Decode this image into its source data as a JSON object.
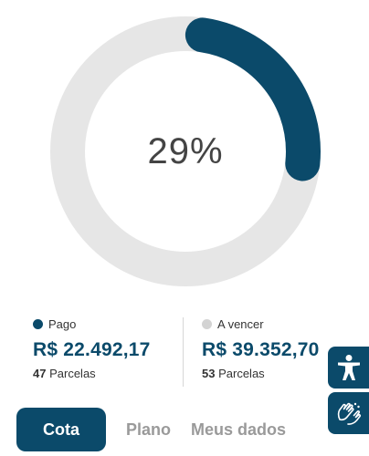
{
  "progress": {
    "percent_label": "29%",
    "fraction": 0.29,
    "colors": {
      "filled": "#0b4a6a",
      "track": "#e6e6e6"
    }
  },
  "summary": {
    "paid": {
      "legend": "Pago",
      "amount": "R$ 22.492,17",
      "count": "47",
      "count_label": "Parcelas",
      "color": "#0b4a6a"
    },
    "due": {
      "legend": "A vencer",
      "amount": "R$ 39.352,70",
      "count": "53",
      "count_label": "Parcelas",
      "color": "#d3d3d3"
    }
  },
  "tabs": [
    {
      "label": "Cota",
      "active": true
    },
    {
      "label": "Plano",
      "active": false
    },
    {
      "label": "Meus dados",
      "active": false
    }
  ],
  "accessibility": {
    "icons": [
      "accessibility-person-icon",
      "sign-language-hands-icon"
    ]
  }
}
